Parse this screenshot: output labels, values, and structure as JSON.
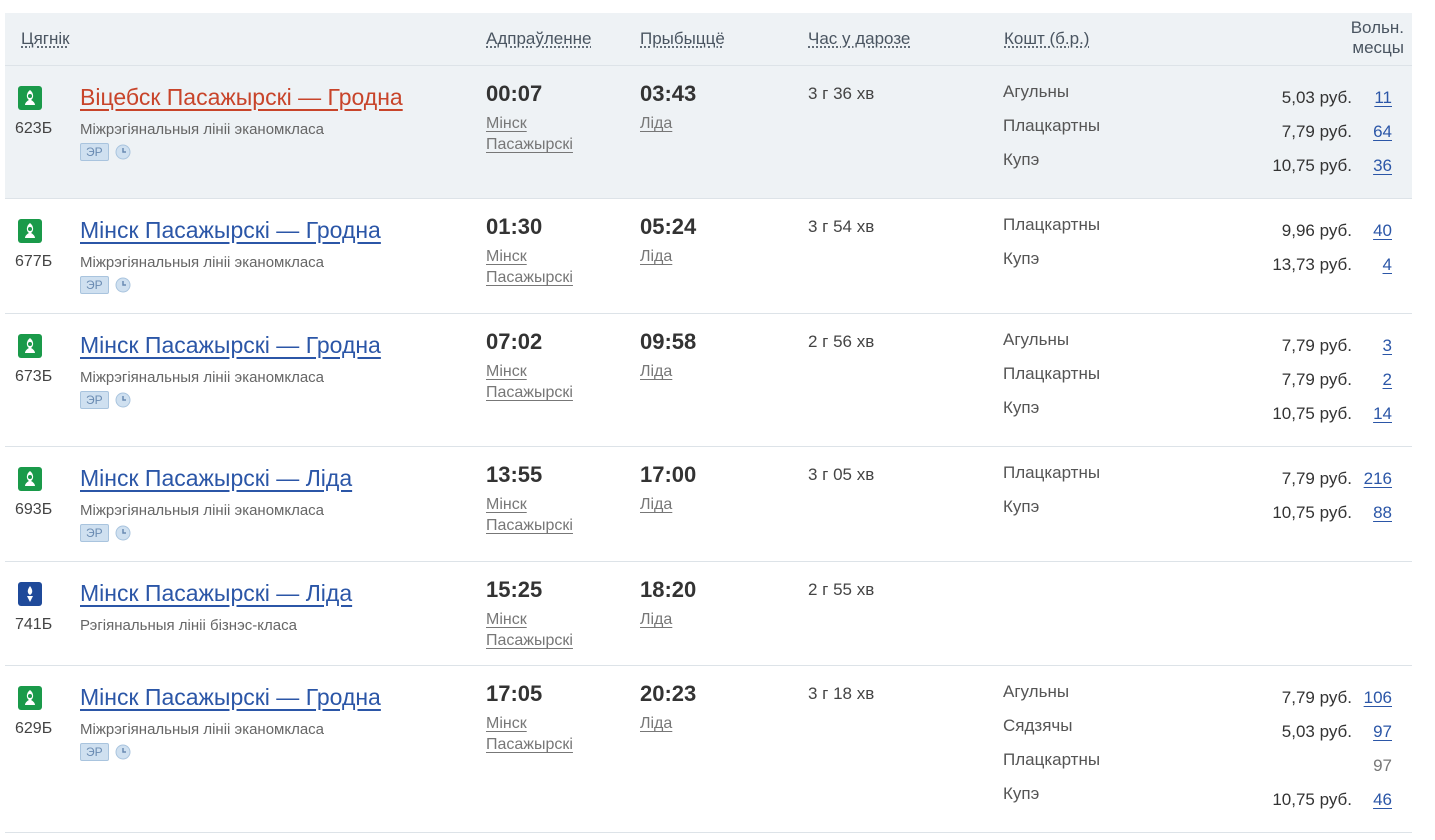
{
  "header": {
    "train": "Цягнік",
    "departure": "Адпраўленне",
    "arrival": "Прыбыццё",
    "duration": "Час у дарозе",
    "cost": "Кошт (б.р.)",
    "seats_line1": "Вольн.",
    "seats_line2": "месцы"
  },
  "colors": {
    "link": "#2b56a7",
    "link_active": "#c8442a",
    "green_badge": "#1a9a4a",
    "blue_badge": "#1f4a9a",
    "row_highlight": "#eef2f5"
  },
  "trains": [
    {
      "number": "623Б",
      "route": "Віцебск Пасажырскі — Гродна",
      "type": "Міжрэгіянальныя лініі эканомкласа",
      "tag": "ЭР",
      "icon": "green-train-icon",
      "dep_time": "00:07",
      "dep_station_1": "Мінск",
      "dep_station_2": "Пасажырскі",
      "arr_time": "03:43",
      "arr_station": "Ліда",
      "duration": "3 г 36 хв",
      "classes": [
        {
          "name": "Агульны",
          "price": "5,03 руб.",
          "seats": "11"
        },
        {
          "name": "Плацкартны",
          "price": "7,79 руб.",
          "seats": "64"
        },
        {
          "name": "Купэ",
          "price": "10,75 руб.",
          "seats": "36"
        }
      ]
    },
    {
      "number": "677Б",
      "route": "Мінск Пасажырскі — Гродна",
      "type": "Міжрэгіянальныя лініі эканомкласа",
      "tag": "ЭР",
      "icon": "green-train-icon",
      "dep_time": "01:30",
      "dep_station_1": "Мінск",
      "dep_station_2": "Пасажырскі",
      "arr_time": "05:24",
      "arr_station": "Ліда",
      "duration": "3 г 54 хв",
      "classes": [
        {
          "name": "Плацкартны",
          "price": "9,96 руб.",
          "seats": "40"
        },
        {
          "name": "Купэ",
          "price": "13,73 руб.",
          "seats": "4"
        }
      ]
    },
    {
      "number": "673Б",
      "route": "Мінск Пасажырскі — Гродна",
      "type": "Міжрэгіянальныя лініі эканомкласа",
      "tag": "ЭР",
      "icon": "green-train-icon",
      "dep_time": "07:02",
      "dep_station_1": "Мінск",
      "dep_station_2": "Пасажырскі",
      "arr_time": "09:58",
      "arr_station": "Ліда",
      "duration": "2 г 56 хв",
      "classes": [
        {
          "name": "Агульны",
          "price": "7,79 руб.",
          "seats": "3"
        },
        {
          "name": "Плацкартны",
          "price": "7,79 руб.",
          "seats": "2"
        },
        {
          "name": "Купэ",
          "price": "10,75 руб.",
          "seats": "14"
        }
      ]
    },
    {
      "number": "693Б",
      "route": "Мінск Пасажырскі — Ліда",
      "type": "Міжрэгіянальныя лініі эканомкласа",
      "tag": "ЭР",
      "icon": "green-train-icon",
      "dep_time": "13:55",
      "dep_station_1": "Мінск",
      "dep_station_2": "Пасажырскі",
      "arr_time": "17:00",
      "arr_station": "Ліда",
      "duration": "3 г 05 хв",
      "classes": [
        {
          "name": "Плацкартны",
          "price": "7,79 руб.",
          "seats": "216"
        },
        {
          "name": "Купэ",
          "price": "10,75 руб.",
          "seats": "88"
        }
      ]
    },
    {
      "number": "741Б",
      "route": "Мінск Пасажырскі — Ліда",
      "type": "Рэгіянальныя лініі бізнэс-класа",
      "icon": "blue-train-icon",
      "dep_time": "15:25",
      "dep_station_1": "Мінск",
      "dep_station_2": "Пасажырскі",
      "arr_time": "18:20",
      "arr_station": "Ліда",
      "duration": "2 г 55 хв",
      "classes": []
    },
    {
      "number": "629Б",
      "route": "Мінск Пасажырскі — Гродна",
      "type": "Міжрэгіянальныя лініі эканомкласа",
      "tag": "ЭР",
      "icon": "green-train-icon",
      "dep_time": "17:05",
      "dep_station_1": "Мінск",
      "dep_station_2": "Пасажырскі",
      "arr_time": "20:23",
      "arr_station": "Ліда",
      "duration": "3 г 18 хв",
      "classes": [
        {
          "name": "Агульны",
          "price": "7,79 руб.",
          "seats": "106"
        },
        {
          "name": "Сядзячы",
          "price": "5,03 руб.",
          "seats": "97"
        },
        {
          "name": "Плацкартны",
          "price": "",
          "seats": "97"
        },
        {
          "name": "Купэ",
          "price": "10,75 руб.",
          "seats": "46"
        }
      ]
    }
  ]
}
